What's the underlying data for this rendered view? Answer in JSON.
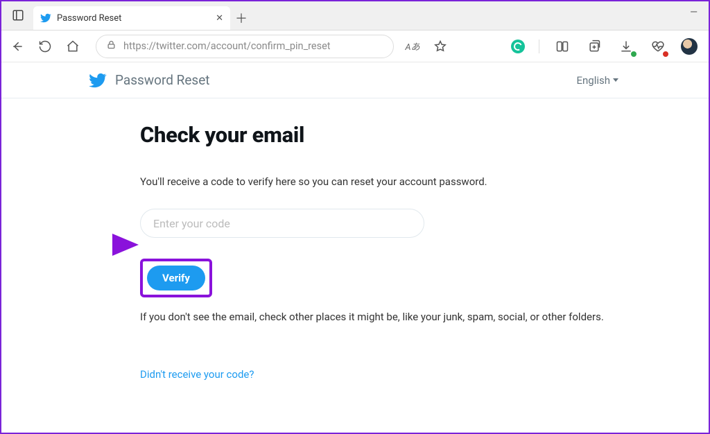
{
  "browser": {
    "tab_title": "Password Reset",
    "url": "https://twitter.com/account/confirm_pin_reset",
    "reader_label": "Aあ"
  },
  "page_header": {
    "title": "Password Reset",
    "language": "English"
  },
  "content": {
    "heading": "Check your email",
    "subtext": "You'll receive a code to verify here so you can reset your account password.",
    "code_placeholder": "Enter your code",
    "verify_label": "Verify",
    "advice": "If you don't see the email, check other places it might be, like your junk, spam, social, or other folders.",
    "resend_link": "Didn't receive your code?"
  },
  "icons": {
    "back": "back-arrow-icon",
    "refresh": "refresh-icon",
    "home": "home-icon",
    "lock": "lock-icon",
    "favorite": "star-icon",
    "split": "split-screen-icon",
    "collections": "collections-icon",
    "downloads": "download-icon",
    "health": "heartbeat-icon",
    "grammarly": "grammarly-icon",
    "avatar": "profile-avatar",
    "twitter": "twitter-bird-icon",
    "close": "close-icon",
    "newtab": "plus-icon",
    "minimize": "minimize-icon",
    "tv": "tab-actions-icon"
  },
  "colors": {
    "twitter_blue": "#1d9bf0",
    "annotation_purple": "#8a12db"
  }
}
